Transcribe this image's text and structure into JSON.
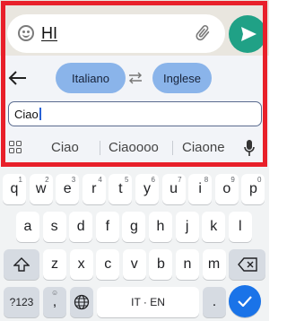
{
  "composer": {
    "message_text": "HI",
    "emoji_icon": "emoji-icon",
    "attach_icon": "paperclip-icon",
    "send_icon": "send-icon"
  },
  "translate": {
    "source_lang": "Italiano",
    "target_lang": "Inglese",
    "input_value": "Ciao"
  },
  "suggestions": [
    "Ciao",
    "Ciaoooo",
    "Ciaone"
  ],
  "keyboard": {
    "row1": [
      {
        "k": "q",
        "h": "1"
      },
      {
        "k": "w",
        "h": "2"
      },
      {
        "k": "e",
        "h": "3"
      },
      {
        "k": "r",
        "h": "4"
      },
      {
        "k": "t",
        "h": "5"
      },
      {
        "k": "y",
        "h": "6"
      },
      {
        "k": "u",
        "h": "7"
      },
      {
        "k": "i",
        "h": "8"
      },
      {
        "k": "o",
        "h": "9"
      },
      {
        "k": "p",
        "h": "0"
      }
    ],
    "row2": [
      "a",
      "s",
      "d",
      "f",
      "g",
      "h",
      "j",
      "k",
      "l"
    ],
    "row3": [
      "z",
      "x",
      "c",
      "v",
      "b",
      "n",
      "m"
    ],
    "symbols_label": "?123",
    "comma": ",",
    "space_label": "IT · EN",
    "period": "."
  },
  "colors": {
    "send": "#20a186",
    "lang_pill": "#8ab4ea",
    "enter": "#1a73e8",
    "highlight": "#e8202a"
  }
}
